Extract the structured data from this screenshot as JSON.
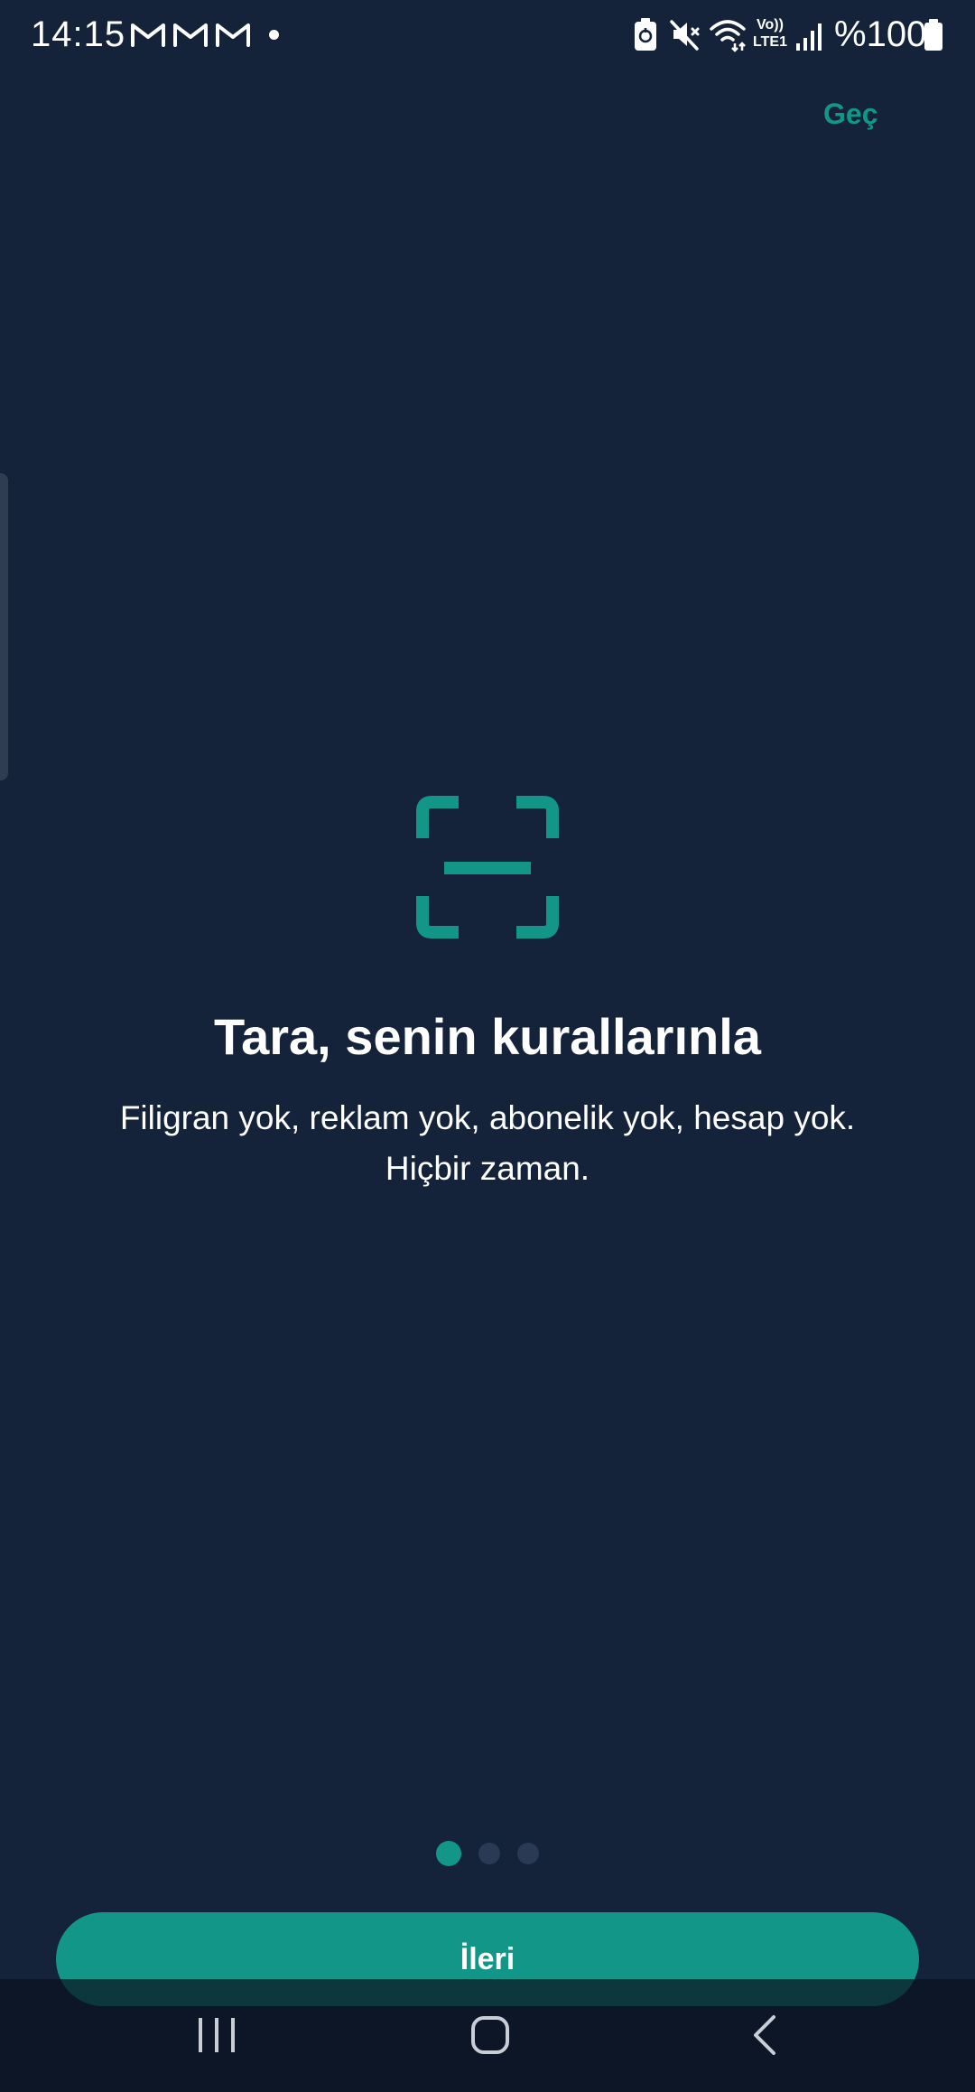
{
  "status_bar": {
    "time": "14:15",
    "notification_icons": [
      "gmail-icon",
      "gmail-icon",
      "gmail-icon",
      "more-notifications-dot"
    ],
    "lte_label_top": "Vo))",
    "lte_label_bottom": "LTE1",
    "battery_text": "%100"
  },
  "onboarding": {
    "skip_label": "Geç",
    "icon": "scan-frame-icon",
    "title": "Tara, senin kurallarınla",
    "subtitle_line1": "Filigran yok, reklam yok, abonelik yok, hesap yok.",
    "subtitle_line2": "Hiçbir zaman.",
    "page_count": 3,
    "current_page": 1,
    "next_label": "İleri"
  },
  "colors": {
    "background": "#14223a",
    "accent": "#129688",
    "dot_inactive": "#2a3a55",
    "text": "#ffffff"
  }
}
